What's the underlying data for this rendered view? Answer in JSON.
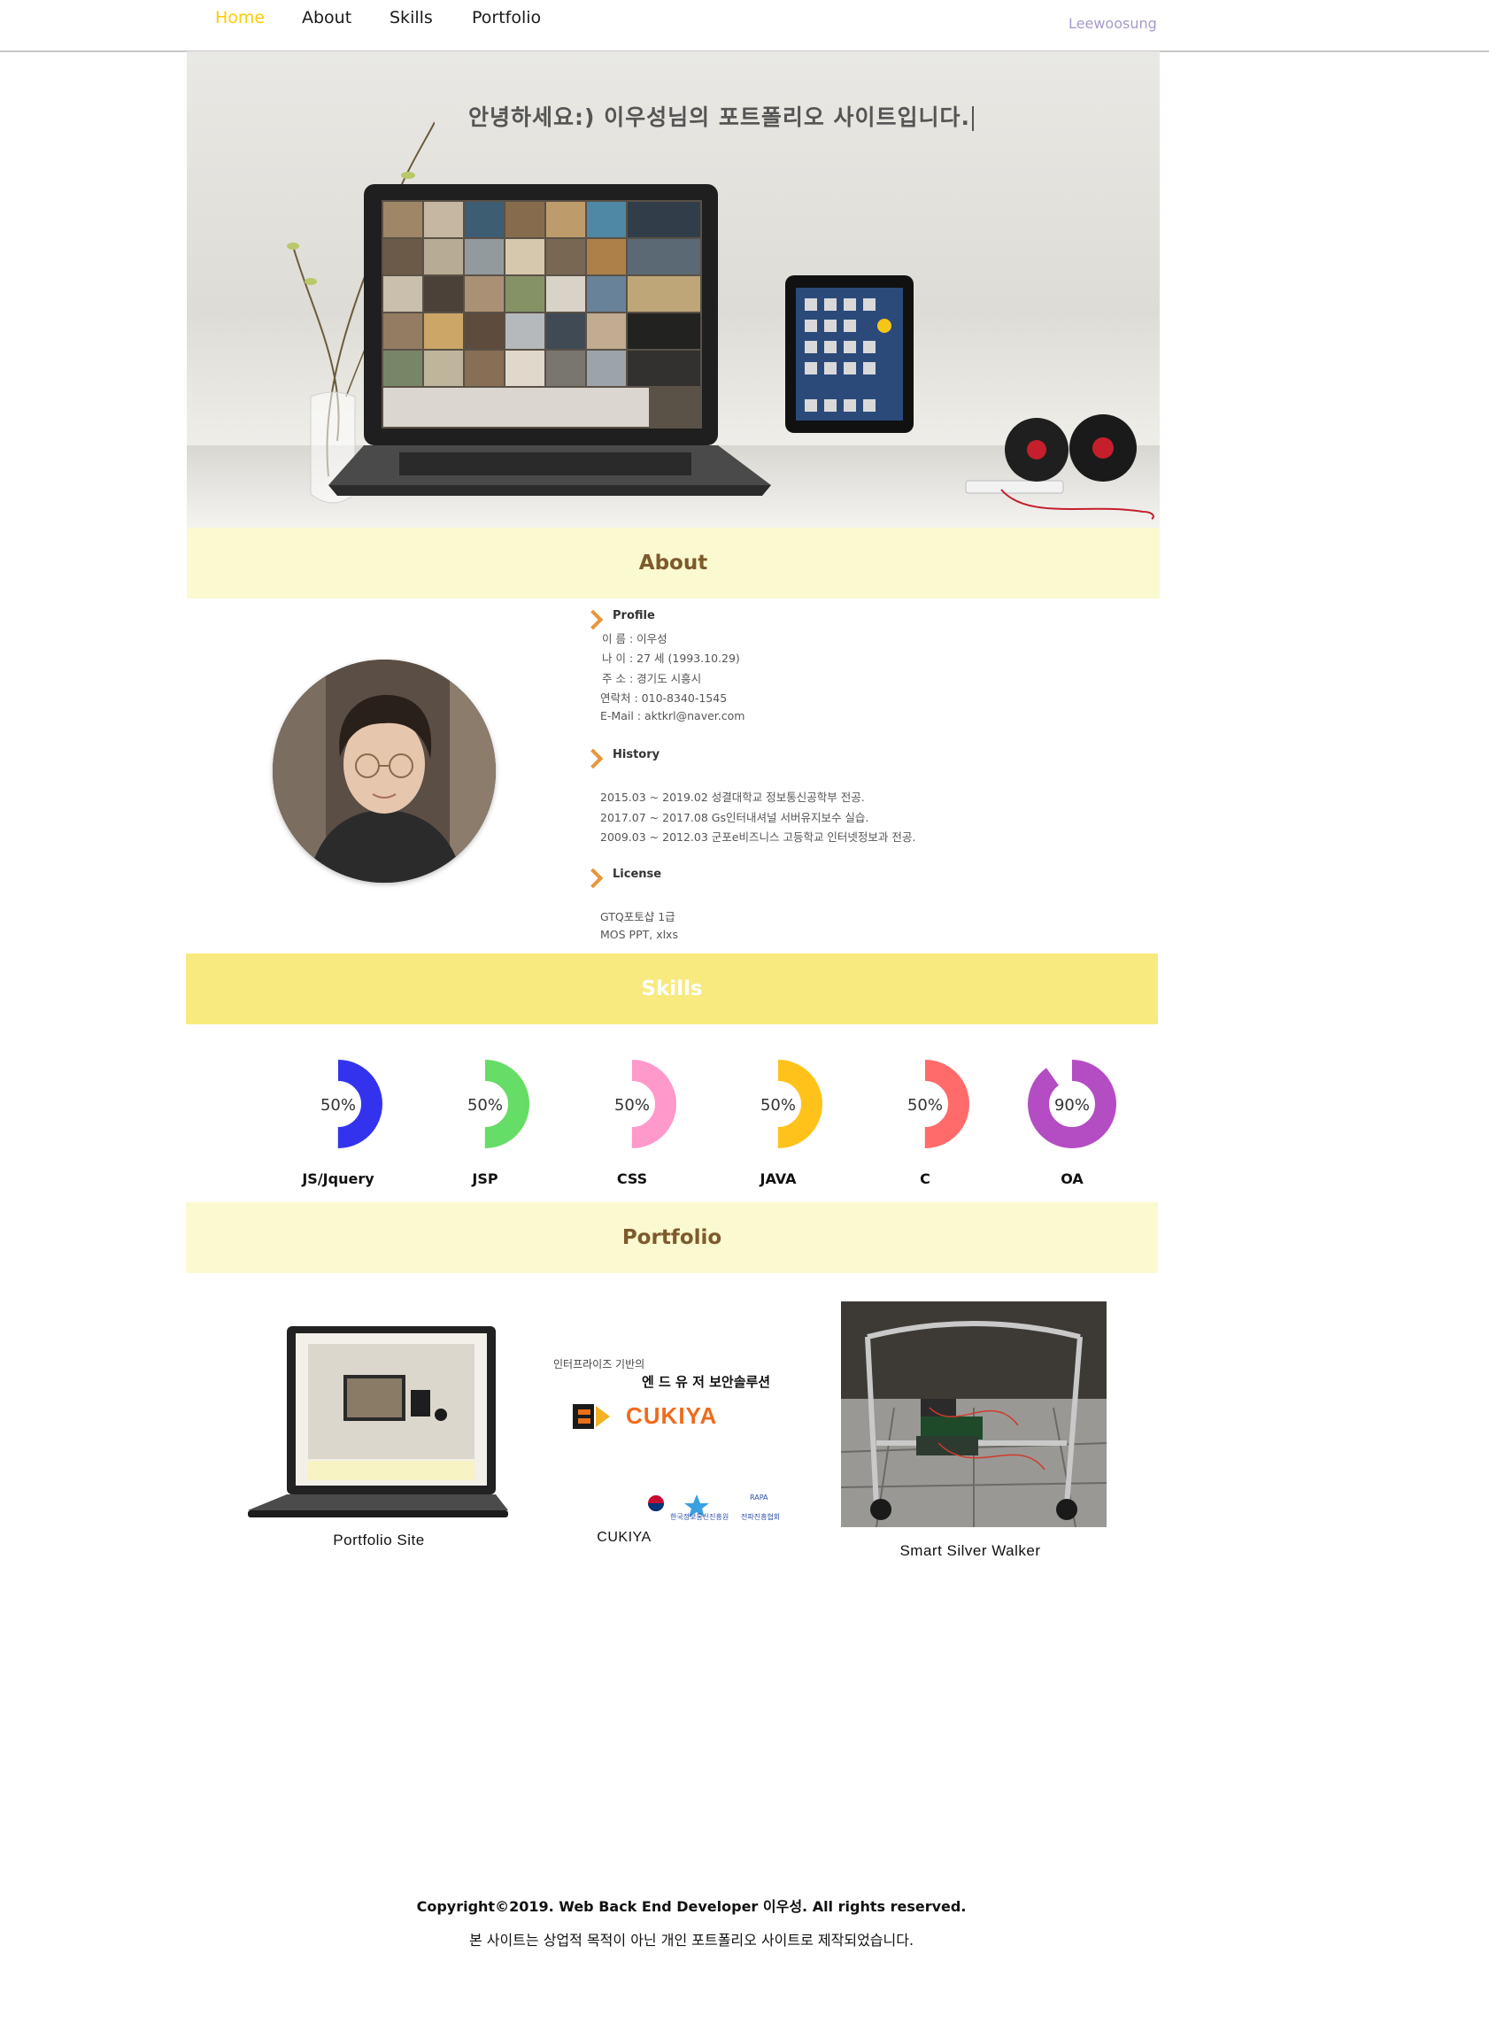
{
  "nav": {
    "items": [
      {
        "label": "Home",
        "active": true
      },
      {
        "label": "About",
        "active": false
      },
      {
        "label": "Skills",
        "active": false
      },
      {
        "label": "Portfolio",
        "active": false
      }
    ],
    "brand": "Leewoosung"
  },
  "hero": {
    "title": "안녕하세요:) 이우성님의 포트폴리오 사이트입니다."
  },
  "about": {
    "heading": "About",
    "profile": {
      "title": "Profile",
      "lines": [
        "이  름 : 이우성",
        "나  이 : 27 세 (1993.10.29)",
        "주  소 : 경기도 시흥시",
        "연락처 : 010-8340-1545",
        "E-Mail : aktkrl@naver.com"
      ]
    },
    "history": {
      "title": "History",
      "lines": [
        "2015.03 ~ 2019.02 성결대학교 정보통신공학부 전공.",
        "2017.07 ~ 2017.08 Gs인터내셔널 서버유지보수 실습.",
        "2009.03 ~ 2012.03 군포e비즈니스 고등학교 인터넷정보과 전공."
      ]
    },
    "license": {
      "title": "License",
      "lines": [
        "GTQ포토샵 1급",
        "MOS PPT, xlxs"
      ]
    }
  },
  "skills": {
    "heading": "Skills",
    "items": [
      {
        "name": "JS/Jquery",
        "percent": 50,
        "label": "50%",
        "color": "#3333ee"
      },
      {
        "name": "JSP",
        "percent": 50,
        "label": "50%",
        "color": "#66dd66"
      },
      {
        "name": "CSS",
        "percent": 50,
        "label": "50%",
        "color": "#ff99cc"
      },
      {
        "name": "JAVA",
        "percent": 50,
        "label": "50%",
        "color": "#ffc21a"
      },
      {
        "name": "C",
        "percent": 50,
        "label": "50%",
        "color": "#ff6b6b"
      },
      {
        "name": "OA",
        "percent": 90,
        "label": "90%",
        "color": "#b44cc4"
      }
    ]
  },
  "portfolio": {
    "heading": "Portfolio",
    "items": [
      {
        "title": "Portfolio Site"
      },
      {
        "title": "CUKIYA",
        "tagline": "인터프라이즈 기반의",
        "subtitle": "엔 드 유 저 보안솔루션",
        "brand": "CUKIYA"
      },
      {
        "title": "Smart Silver Walker"
      }
    ]
  },
  "footer": {
    "copyright": "Copyright©2019. Web Back End Developer 이우성. All rights reserved.",
    "note": "본 사이트는 상업적 목적이 아닌 개인 포트폴리오 사이트로 제작되었습니다."
  }
}
